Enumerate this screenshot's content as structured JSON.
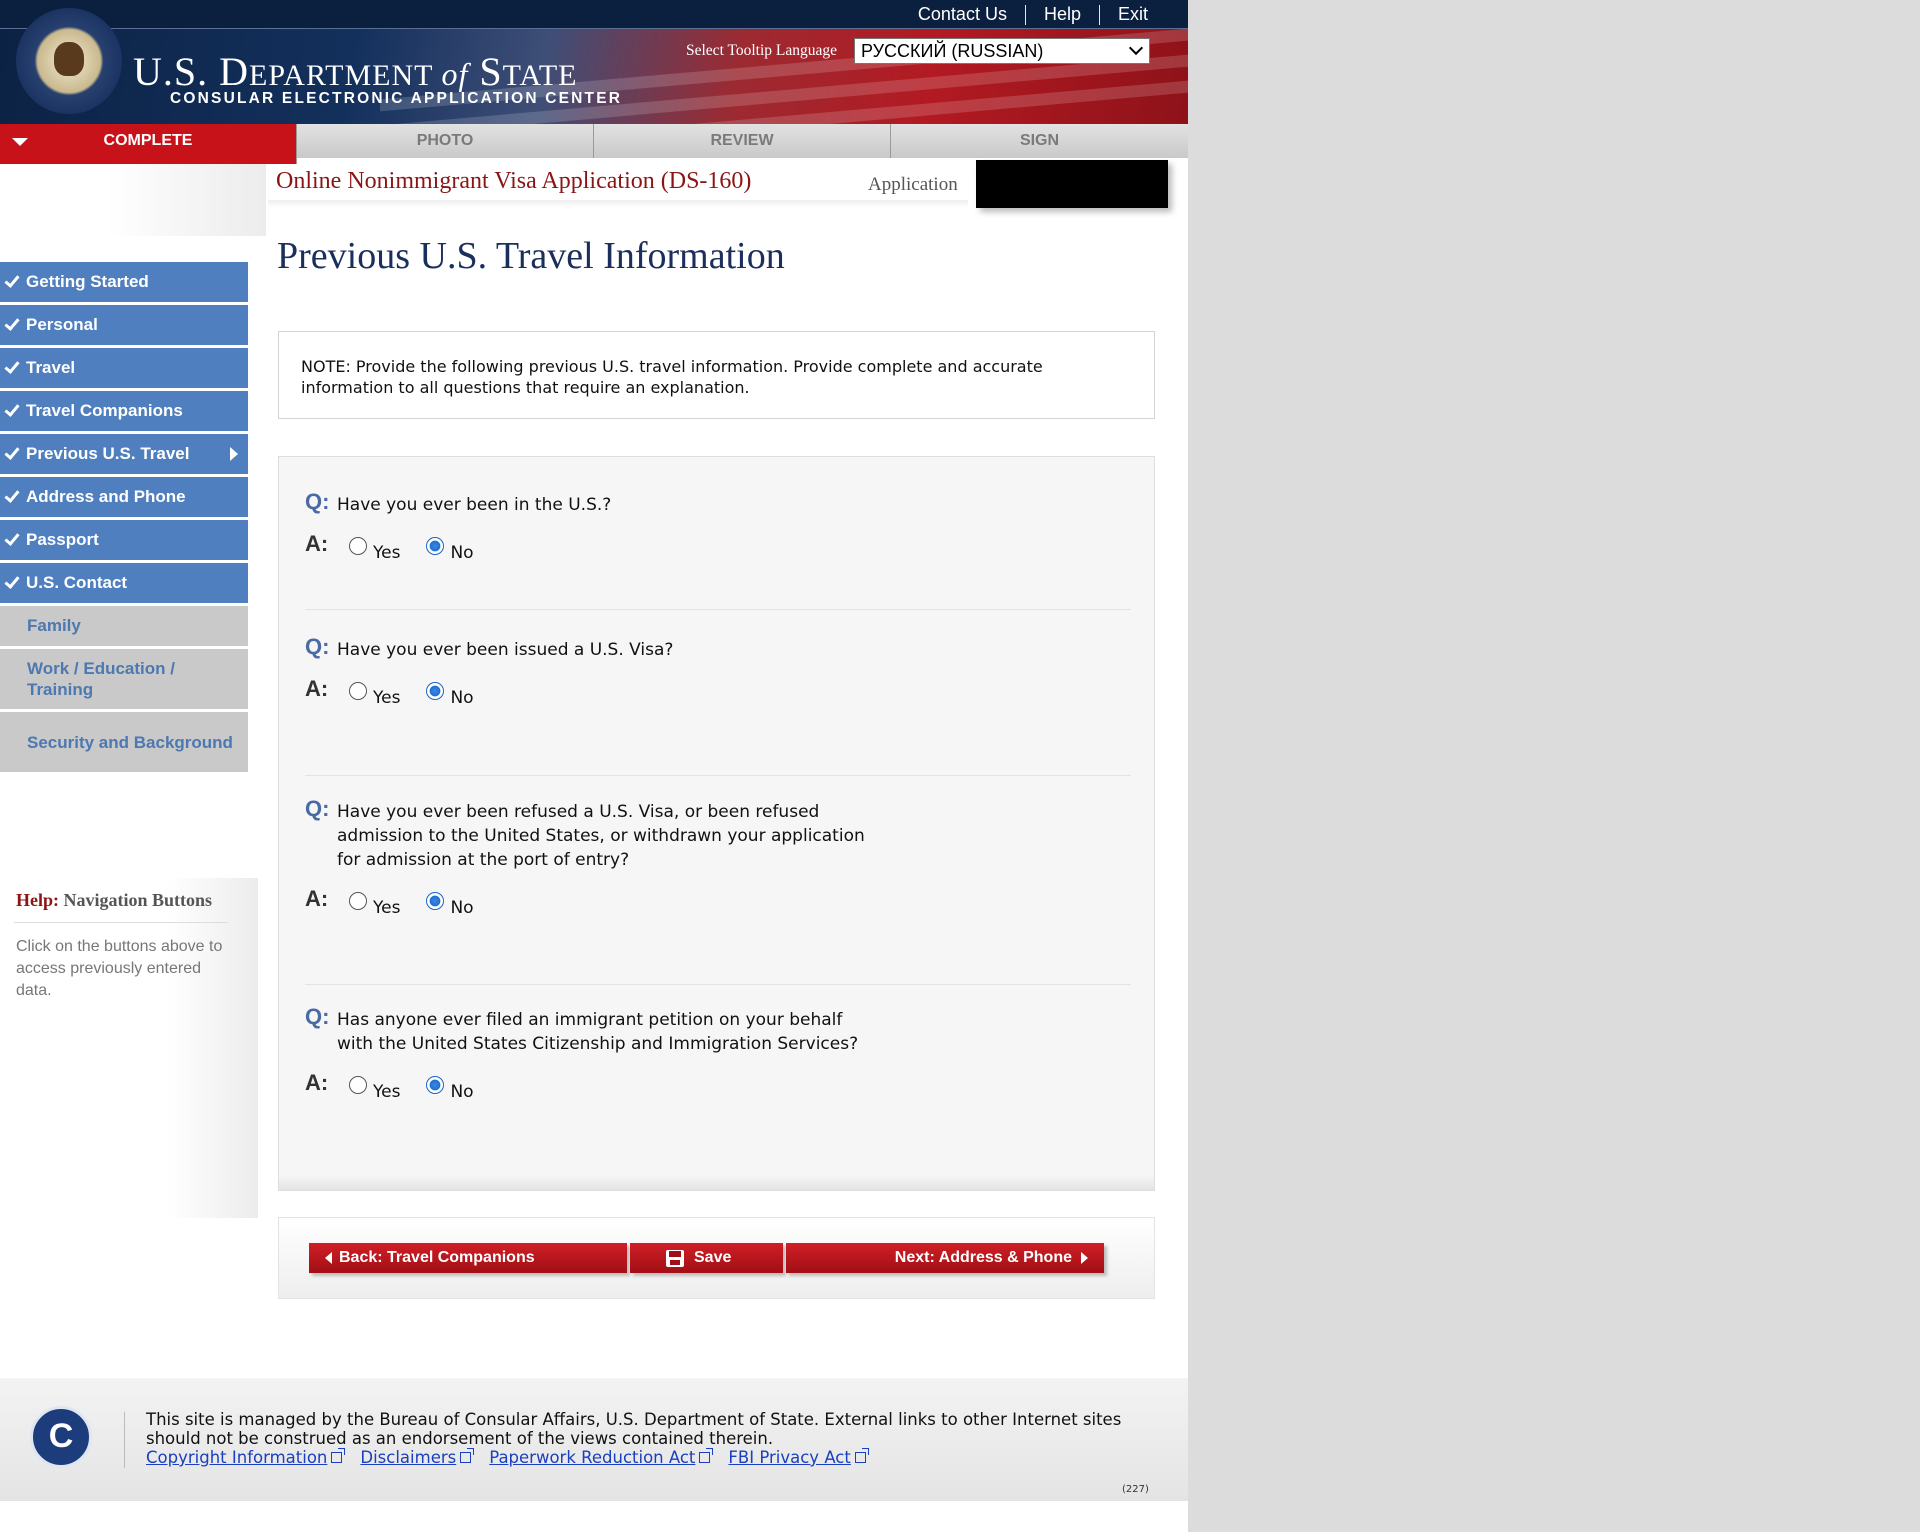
{
  "header": {
    "links": [
      "Contact Us",
      "Help",
      "Exit"
    ],
    "brand_title_a": "U.S. D",
    "brand_title_b": "EPARTMENT ",
    "brand_title_of": "of",
    "brand_title_c": " S",
    "brand_title_d": "TATE",
    "brand_subtitle": "CONSULAR ELECTRONIC APPLICATION CENTER",
    "tooltip_language_label": "Select Tooltip Language",
    "tooltip_language_value": "РУССКИЙ (RUSSIAN)"
  },
  "tabs": [
    {
      "label": "COMPLETE",
      "active": true
    },
    {
      "label": "PHOTO",
      "active": false
    },
    {
      "label": "REVIEW",
      "active": false
    },
    {
      "label": "SIGN",
      "active": false
    }
  ],
  "form": {
    "title": "Online Nonimmigrant Visa Application (DS-160)",
    "application_label": "Application"
  },
  "page_title": "Previous U.S. Travel Information",
  "sidebar": {
    "items": [
      {
        "label": "Getting Started",
        "status": "done"
      },
      {
        "label": "Personal",
        "status": "done"
      },
      {
        "label": "Travel",
        "status": "done"
      },
      {
        "label": "Travel Companions",
        "status": "done"
      },
      {
        "label": "Previous U.S. Travel",
        "status": "done",
        "current": true
      },
      {
        "label": "Address and Phone",
        "status": "done"
      },
      {
        "label": "Passport",
        "status": "done"
      },
      {
        "label": "U.S. Contact",
        "status": "done"
      },
      {
        "label": "Family",
        "status": "todo"
      },
      {
        "label": "Work / Education / Training",
        "status": "todo"
      },
      {
        "label": "Security and Background",
        "status": "todo"
      }
    ]
  },
  "help": {
    "prefix": "Help:",
    "title": "Navigation Buttons",
    "text": "Click on the buttons above to access previously entered data."
  },
  "note": "NOTE: Provide the following previous U.S. travel information. Provide complete and accurate information to all questions that require an explanation.",
  "questions": {
    "q_label": "Q:",
    "a_label": "A:",
    "yes_label": "Yes",
    "no_label": "No",
    "items": [
      {
        "text": "Have you ever been in the U.S.?",
        "answer": "No"
      },
      {
        "text": "Have you ever been issued a U.S. Visa?",
        "answer": "No"
      },
      {
        "text": "Have you ever been refused a U.S. Visa, or been refused admission to the United States, or withdrawn your application for admission at the port of entry?",
        "answer": "No"
      },
      {
        "text": "Has anyone ever filed an immigrant petition on your behalf with the United States Citizenship and Immigration Services?",
        "answer": "No"
      }
    ]
  },
  "buttons": {
    "back": "Back: Travel Companions",
    "save": "Save",
    "next": "Next: Address & Phone"
  },
  "footer": {
    "logo_letter": "C",
    "text": "This site is managed by the Bureau of Consular Affairs, U.S. Department of State. External links to other Internet sites should not be construed as an endorsement of the views contained therein.",
    "links": [
      "Copyright Information",
      "Disclaimers",
      "Paperwork Reduction Act",
      "FBI Privacy Act"
    ],
    "code": "(227)"
  },
  "colors": {
    "nav_done": "#4f7fbf",
    "nav_todo": "#c9c9c9",
    "accent_red": "#c8121a",
    "navy": "#1c2f5c"
  }
}
